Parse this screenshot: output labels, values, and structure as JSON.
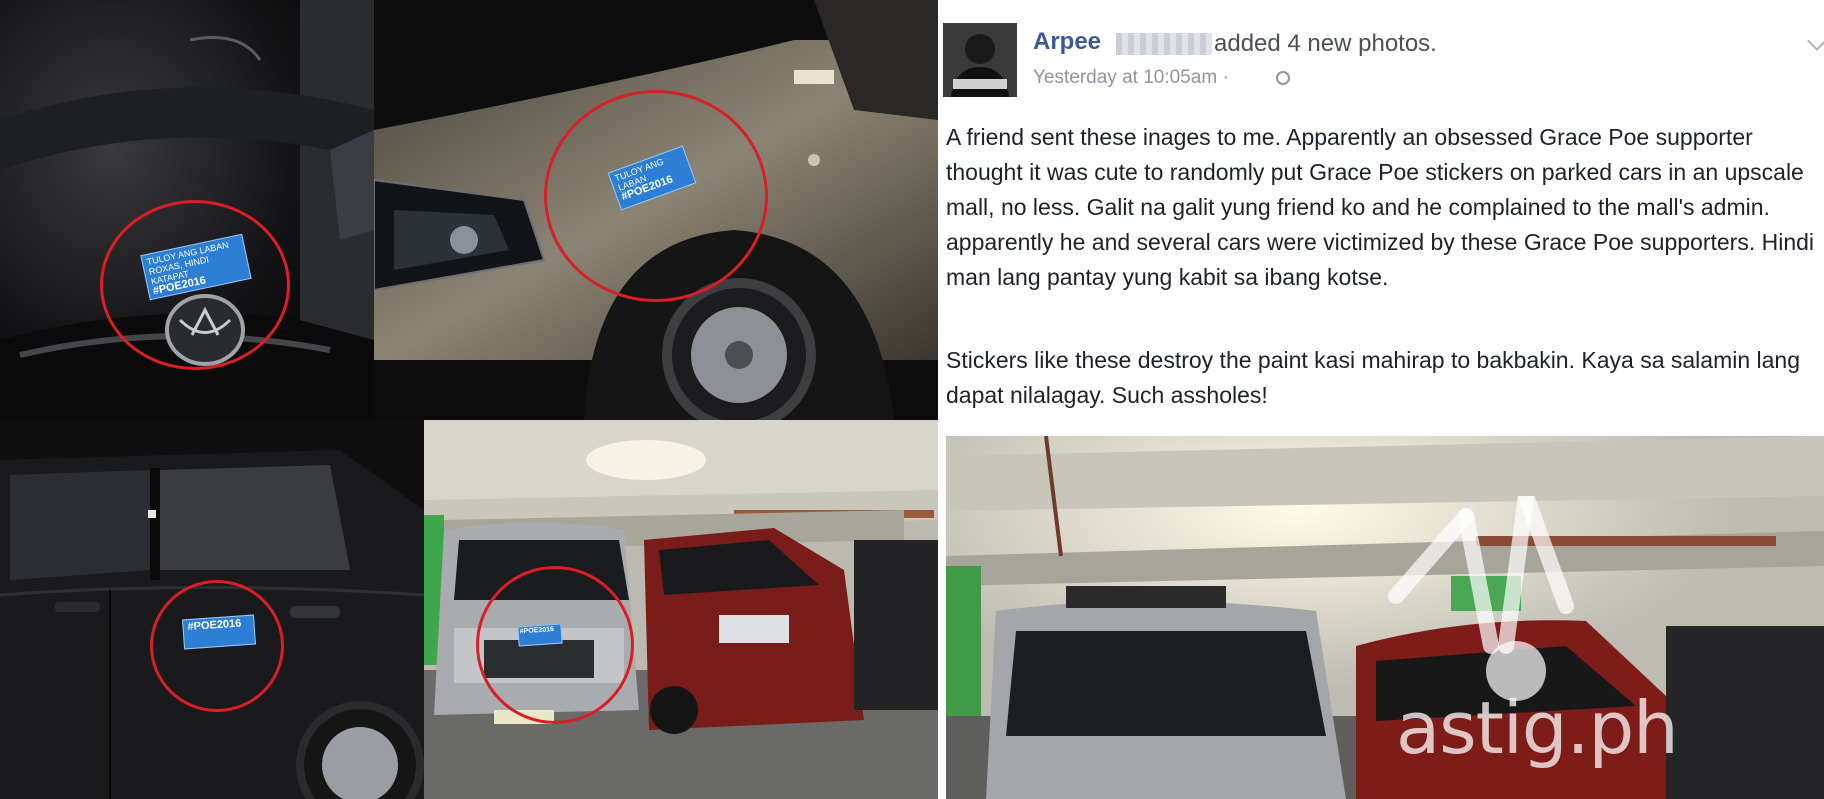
{
  "post": {
    "author": "Arpee",
    "action": "added 4 new photos.",
    "time": "Yesterday at 10:05am",
    "separator": "·",
    "privacy_icon": "globe-icon",
    "menu_icon": "chevron-down-icon",
    "paragraphs": [
      "A friend sent these inages to me. Apparently an obsessed Grace Poe supporter thought it was cute to randomly put Grace Poe stickers on parked cars in an upscale mall, no less. Galit na galit yung friend ko and he complained to the mall's admin. apparently he and several cars were victimized by these Grace Poe supporters. Hindi man lang pantay yung kabit sa ibang kotse.",
      "Stickers like these destroy the paint kasi mahirap to bakbakin. Kaya sa salamin lang dapat nilalagay. Such assholes!"
    ]
  },
  "sticker": {
    "line1": "TULOY ANG LABAN",
    "line2": "ROXAS, HINDI KATAPAT",
    "hashtag": "#POE2016"
  },
  "watermark": "astig.ph",
  "colors": {
    "link": "#3b5998",
    "highlight_circle": "#d81f26",
    "sticker_blue": "#2d7fd6"
  }
}
